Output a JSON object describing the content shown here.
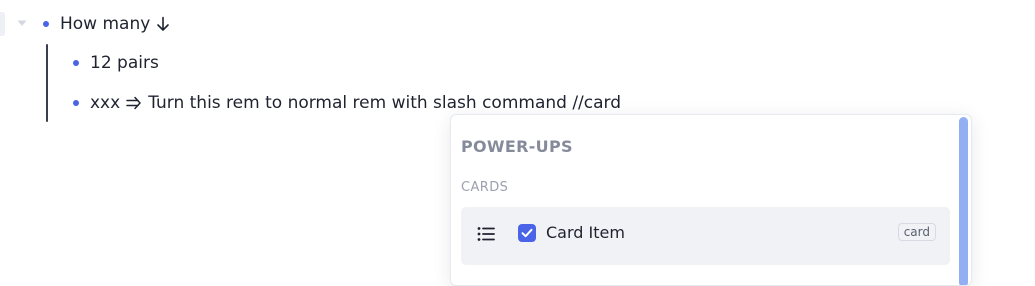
{
  "document": {
    "rems": [
      {
        "text": "How many",
        "icon": "arrow-down-icon"
      },
      {
        "text": "12 pairs"
      },
      {
        "text_before": "xxx",
        "icon": "implies-icon",
        "text_after": "Turn this rem to normal rem with slash command //card"
      }
    ]
  },
  "popup": {
    "title": "POWER-UPS",
    "section": "CARDS",
    "items": [
      {
        "label": "Card Item",
        "badge": "card",
        "checked": true
      }
    ]
  },
  "colors": {
    "bullet": "#4a63e7",
    "checkbox": "#4a63e7",
    "scrollbar": "#93aff3"
  }
}
